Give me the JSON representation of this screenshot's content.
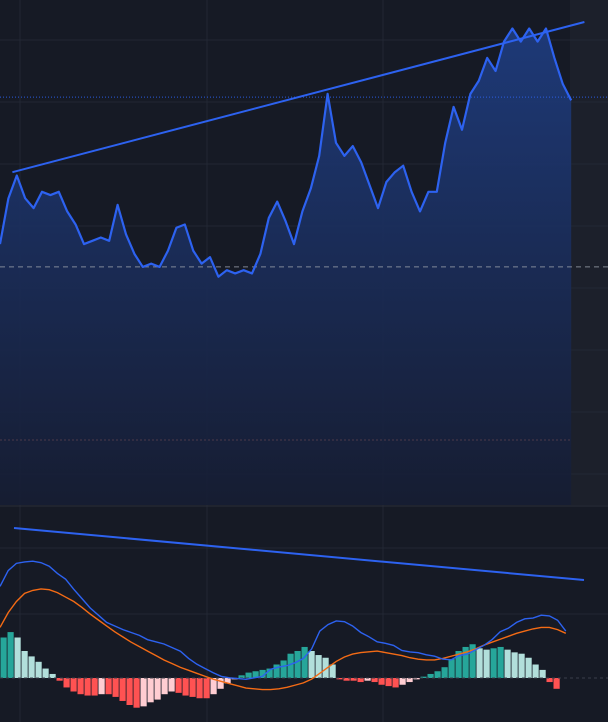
{
  "colors": {
    "background": "#161a25",
    "grid": "#222734",
    "price_line": "#2d62f0",
    "area_top": "#1e3b7c",
    "area_bottom": "#161d33",
    "trendline": "#2d62f0",
    "macd_line": "#2d62f0",
    "signal_line": "#f46b15",
    "hist_pos_strong": "#26a69a",
    "hist_pos_weak": "#b2dfdb",
    "hist_neg_strong": "#ff5252",
    "hist_neg_weak": "#ffcdd2",
    "ref_line": "#9aa0ab",
    "pane_separator": "#2a2e39",
    "blank_right_area": "#1c202b"
  },
  "chart_data": [
    {
      "type": "area",
      "title": "",
      "xlabel": "",
      "ylabel": "",
      "grid": true,
      "legend": "none",
      "x_count": 96,
      "ylim": [
        0,
        100
      ],
      "values": [
        60,
        74,
        81,
        74,
        71,
        76,
        75,
        76,
        70,
        66,
        60,
        61,
        62,
        61,
        72,
        63,
        57,
        53,
        54,
        53,
        58,
        65,
        66,
        58,
        54,
        56,
        50,
        52,
        51,
        52,
        51,
        57,
        68,
        73,
        67,
        60,
        70,
        77,
        87,
        106,
        91,
        87,
        90,
        85,
        78,
        71,
        79,
        82,
        84,
        76,
        70,
        76,
        76,
        91,
        102,
        95,
        106,
        110,
        117,
        113,
        122,
        126,
        122,
        126,
        122,
        126,
        117,
        109,
        104
      ],
      "x_index": [
        0,
        2,
        4,
        6,
        8,
        10,
        12,
        14,
        16,
        18,
        20,
        22,
        24,
        26,
        28,
        30,
        32,
        34,
        36,
        38,
        40,
        42,
        44,
        46,
        48,
        50,
        52,
        54,
        56,
        58,
        60,
        62,
        64,
        66,
        68,
        70,
        72,
        74,
        76,
        78,
        80,
        82,
        84,
        86,
        88,
        90,
        92,
        94,
        96,
        98,
        100,
        102,
        104,
        106,
        108,
        110,
        112,
        114,
        116,
        118,
        120,
        122,
        124,
        126,
        128,
        130,
        132,
        134,
        136
      ],
      "reference_lines": [
        {
          "value": 105,
          "style": "dotted"
        },
        {
          "value": 53,
          "style": "dashed"
        }
      ],
      "trendline": {
        "from": [
          2,
          82
        ],
        "to": [
          142,
          128
        ]
      }
    },
    {
      "type": "line",
      "title": "",
      "xlabel": "",
      "ylabel": "",
      "grid": true,
      "legend": "none",
      "ylim": [
        -100,
        100
      ],
      "zero_line": true,
      "series": [
        {
          "values": [
            30,
            52,
            62,
            64,
            65,
            63,
            58,
            48,
            40,
            26,
            13,
            0,
            -10,
            -20,
            -25,
            -30,
            -34,
            -38,
            -44,
            -47,
            -50,
            -55,
            -60,
            -70,
            -78,
            -84,
            -90,
            -95,
            -97,
            -98,
            -99,
            -97,
            -95,
            -85,
            -82,
            -80,
            -76,
            -70,
            -57,
            -32,
            -23,
            -18,
            -19,
            -25,
            -34,
            -40,
            -47,
            -49,
            -52,
            -59,
            -61,
            -62,
            -65,
            -67,
            -71,
            -72,
            -66,
            -64,
            -58,
            -52,
            -44,
            -33,
            -28,
            -20,
            -15,
            -14,
            -10,
            -11,
            -17,
            -32
          ]
        },
        {
          "values": [
            -10,
            10,
            25,
            36,
            40,
            42,
            41,
            37,
            31,
            25,
            17,
            8,
            0,
            -8,
            -16,
            -23,
            -30,
            -36,
            -42,
            -48,
            -54,
            -59,
            -64,
            -68,
            -72,
            -76,
            -80,
            -83,
            -86,
            -89,
            -92,
            -93,
            -94,
            -94,
            -93,
            -91,
            -88,
            -85,
            -80,
            -72,
            -64,
            -56,
            -50,
            -46,
            -44,
            -43,
            -42,
            -44,
            -46,
            -48,
            -51,
            -53,
            -54,
            -54,
            -52,
            -49,
            -46,
            -43,
            -39,
            -34,
            -30,
            -26,
            -22,
            -18,
            -15,
            -12,
            -10,
            -10,
            -13,
            -18
          ]
        }
      ],
      "histogram": [
        30,
        34,
        30,
        20,
        16,
        12,
        7,
        3,
        -2,
        -7,
        -10,
        -12,
        -13,
        -13,
        -12,
        -12,
        -14,
        -17,
        -20,
        -22,
        -21,
        -18,
        -16,
        -12,
        -10,
        -11,
        -13,
        -14,
        -15,
        -15,
        -12,
        -8,
        -4,
        -1,
        2,
        4,
        5,
        6,
        7,
        10,
        13,
        18,
        20,
        23,
        20,
        17,
        15,
        10,
        -1,
        -2,
        -2,
        -3,
        -2,
        -3,
        -5,
        -6,
        -7,
        -5,
        -3,
        -1,
        1,
        3,
        5,
        8,
        14,
        20,
        23,
        25,
        22,
        21,
        22,
        23,
        21,
        19,
        18,
        15,
        10,
        6,
        -3,
        -8
      ]
    }
  ]
}
